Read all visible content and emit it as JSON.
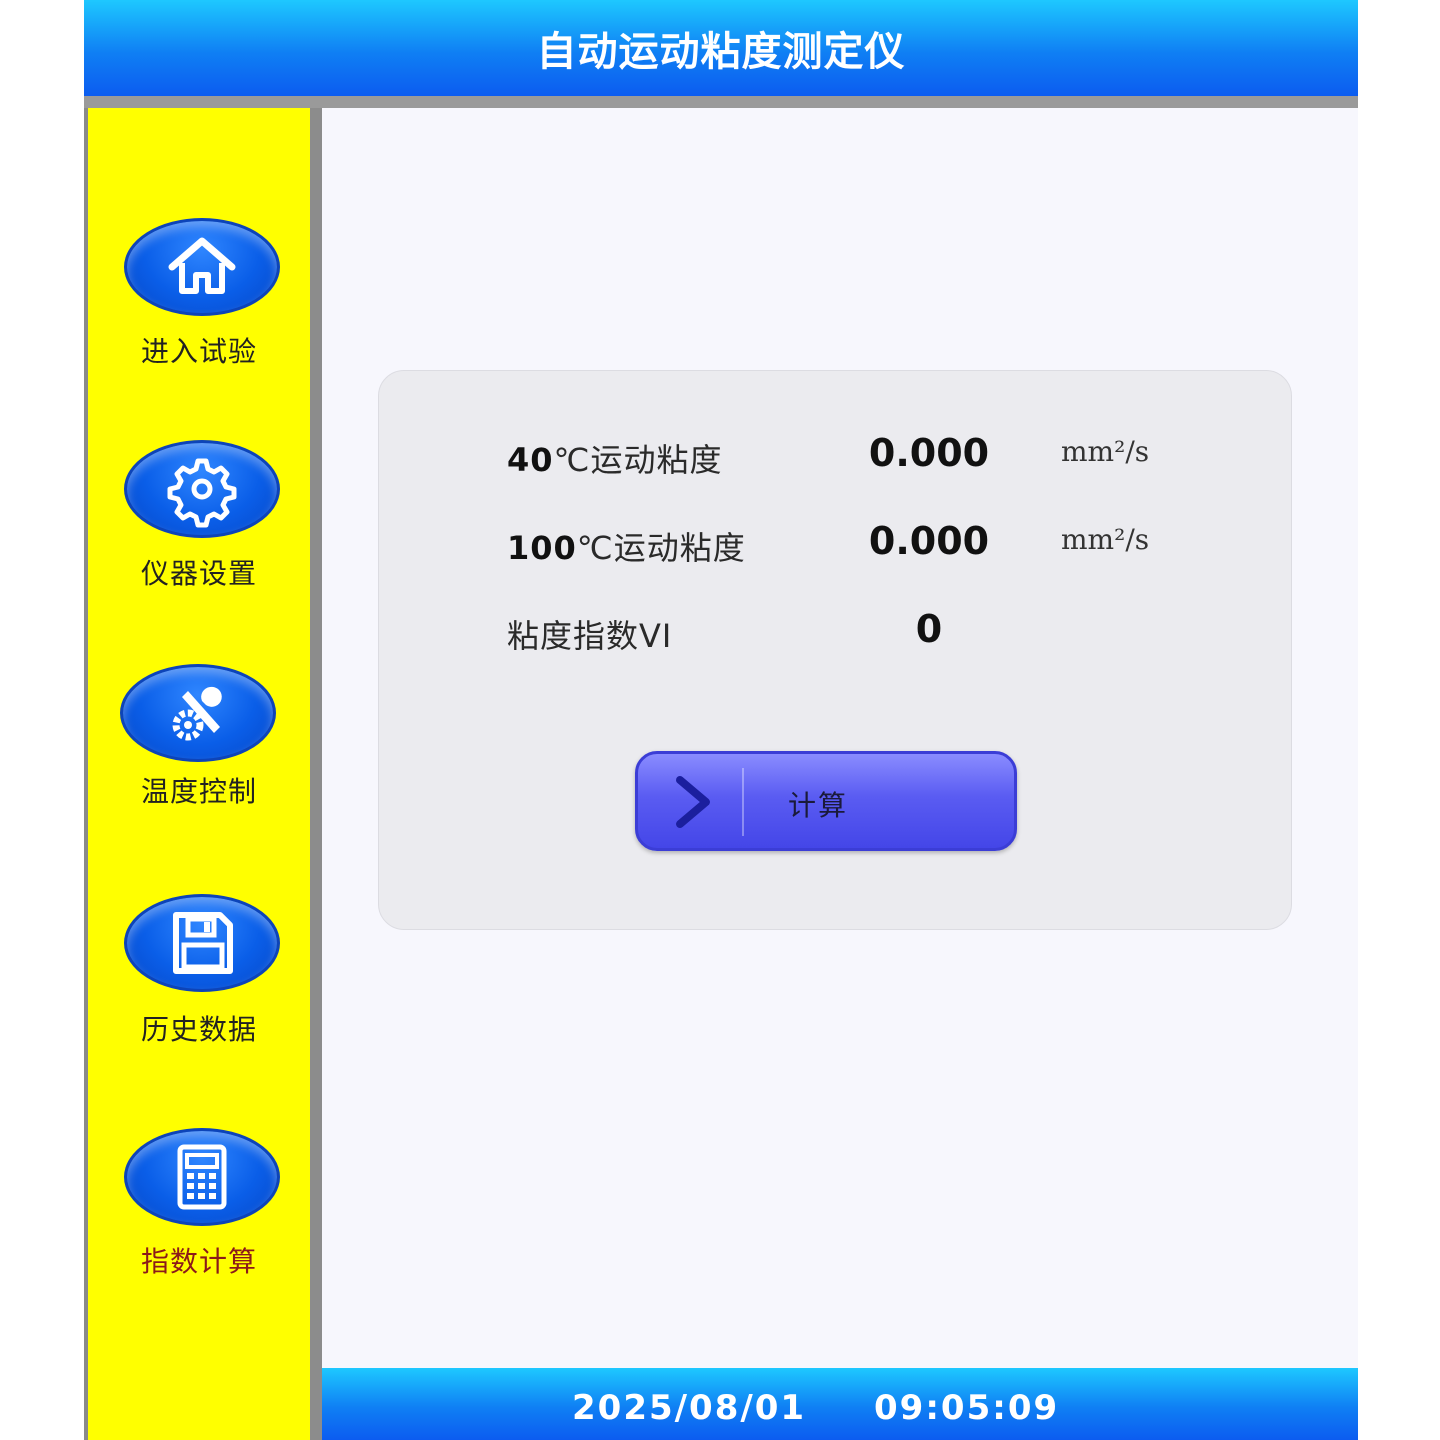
{
  "app": {
    "title": "自动运动粘度测定仪"
  },
  "sidebar": {
    "items": [
      {
        "label": "进入试验",
        "icon": "home-icon"
      },
      {
        "label": "仪器设置",
        "icon": "gear-icon"
      },
      {
        "label": "温度控制",
        "icon": "wrench-gear-icon"
      },
      {
        "label": "历史数据",
        "icon": "floppy-disk-icon"
      },
      {
        "label": "指数计算",
        "icon": "calculator-icon",
        "active": true
      }
    ]
  },
  "results": {
    "rows": [
      {
        "label_num": "40",
        "label_text": "℃运动粘度",
        "value": "0.000",
        "unit": "mm²/s"
      },
      {
        "label_num": "100",
        "label_text": "℃运动粘度",
        "value": "0.000",
        "unit": "mm²/s"
      },
      {
        "label_num": "",
        "label_text": "粘度指数VI",
        "value": "0",
        "unit": ""
      }
    ]
  },
  "calc_button": {
    "label": "计算",
    "icon": "chevron-right-icon"
  },
  "status": {
    "date": "2025/08/01",
    "time": "09:05:09"
  },
  "colors": {
    "header_blue": "#0f7ff4",
    "sidebar_yellow": "#ffff00",
    "button_purple": "#5a5cf2",
    "active_label": "#8b1a1a"
  }
}
